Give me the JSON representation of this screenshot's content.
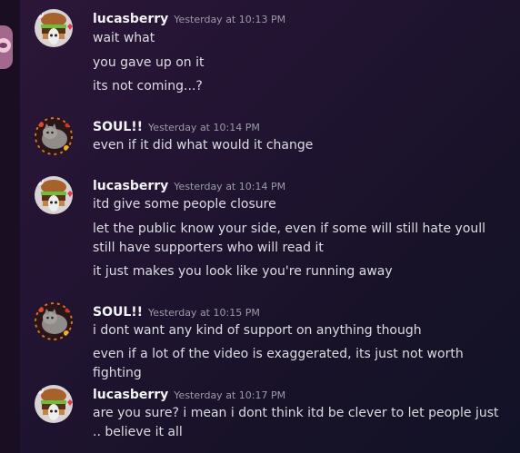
{
  "messages": [
    {
      "author": "lucasberry",
      "timestamp": "Yesterday at 10:13 PM",
      "avatar_icon": "burger-avatar-icon",
      "lines": [
        "wait what",
        "you gave up on it",
        "its not coming...?"
      ]
    },
    {
      "author": "SOUL!!",
      "timestamp": "Yesterday at 10:14 PM",
      "avatar_icon": "gray-cat-avatar-icon",
      "lines": [
        "even if it did what would it change"
      ]
    },
    {
      "author": "lucasberry",
      "timestamp": "Yesterday at 10:14 PM",
      "avatar_icon": "burger-avatar-icon",
      "lines": [
        "itd give some people closure",
        "let the public know your side,  even if some will still hate youll still have supporters who will read it",
        "it just makes you look like you're running away"
      ]
    },
    {
      "author": "SOUL!!",
      "timestamp": "Yesterday at 10:15 PM",
      "avatar_icon": "gray-cat-avatar-icon",
      "lines": [
        "i dont want any kind of support on anything though",
        "even if a lot of the video is exaggerated, its just not worth fighting"
      ]
    },
    {
      "author": "lucasberry",
      "timestamp": "Yesterday at 10:17 PM",
      "avatar_icon": "burger-avatar-icon",
      "lines": [
        "are you sure? i mean i dont think itd be clever to let people just .. believe it all"
      ]
    }
  ],
  "colors": {
    "username": "#f2f3f5",
    "timestamp": "#9b9ca6",
    "message_text": "#dcdde2",
    "background_top": "#2c1638",
    "background_bottom": "#121226"
  }
}
